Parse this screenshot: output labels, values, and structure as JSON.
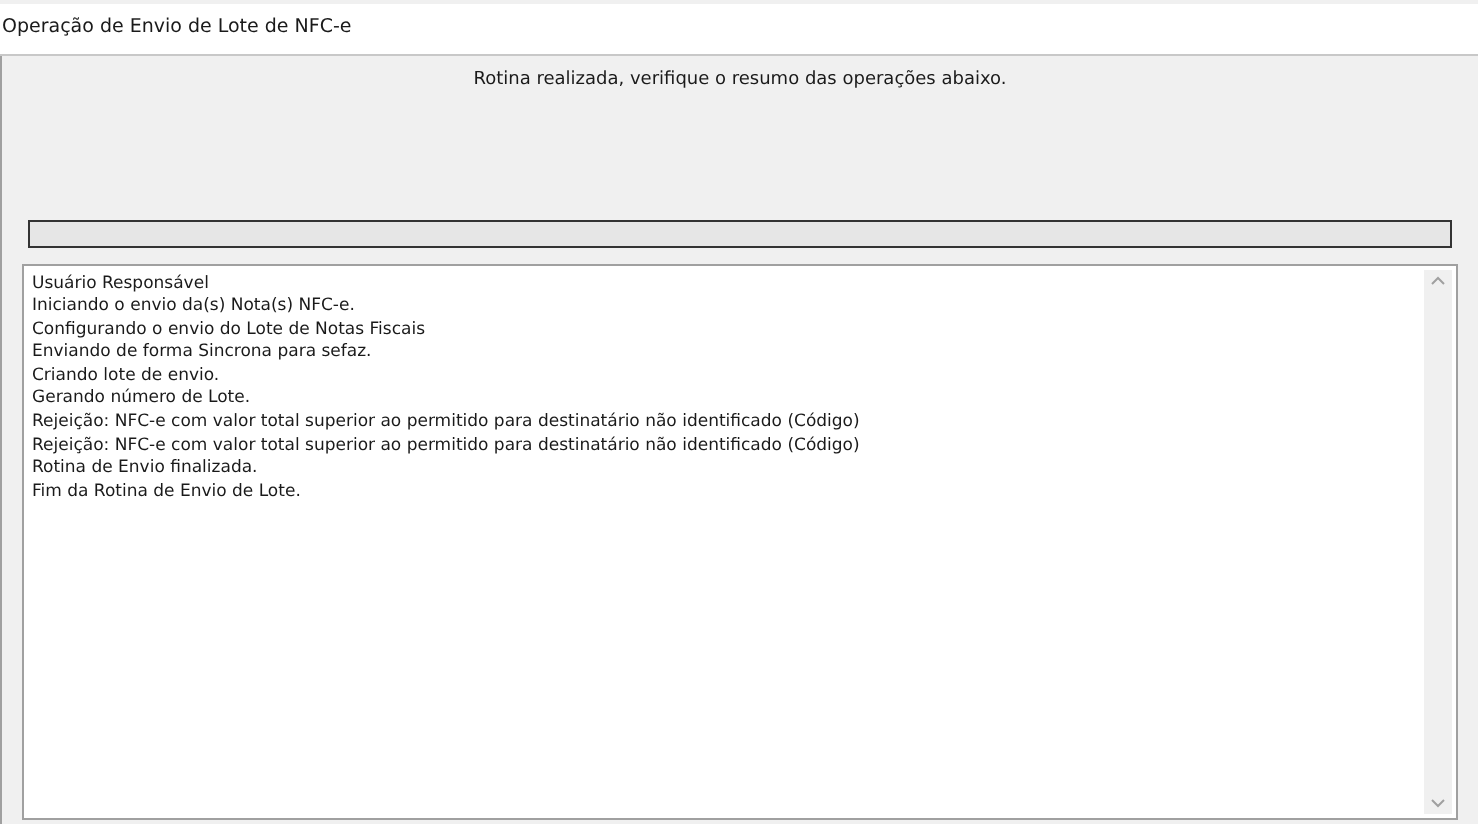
{
  "window": {
    "title": "Operação de Envio de Lote de NFC-e"
  },
  "message": "Rotina realizada, verifique o resumo das operações abaixo.",
  "progress": {
    "level": 0
  },
  "log": [
    "Usuário Responsável",
    "Iniciando o envio da(s) Nota(s) NFC-e.",
    "Configurando o envio do Lote de Notas Fiscais",
    "Enviando de forma Sincrona para sefaz.",
    "Criando lote de envio.",
    "Gerando número de Lote.",
    "Rejeição: NFC-e com valor total superior ao permitido para destinatário não identificado (Código)",
    "Rejeição: NFC-e com valor total superior ao permitido para destinatário não identificado (Código)",
    "Rotina de Envio finalizada.",
    "Fim da Rotina de Envio de Lote."
  ]
}
